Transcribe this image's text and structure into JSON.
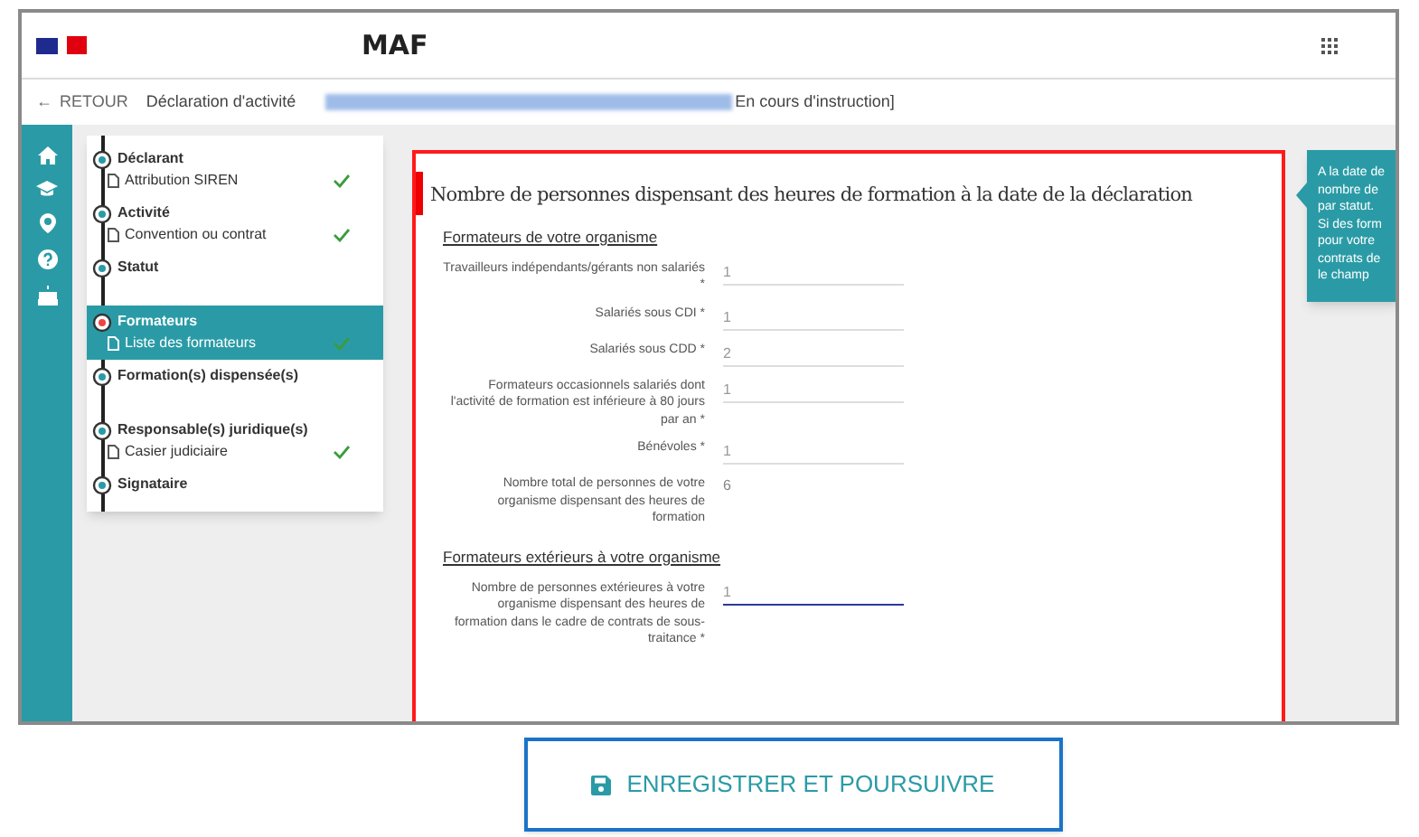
{
  "header": {
    "title": "MAF"
  },
  "breadcrumb": {
    "back_arrow": "←",
    "back": "RETOUR",
    "page": "Déclaration d'activité",
    "status": "En cours d'instruction]"
  },
  "steps": [
    {
      "label": "Déclarant",
      "sub": "Attribution SIREN",
      "checked": true,
      "selected": false
    },
    {
      "label": "Activité",
      "sub": "Convention ou contrat",
      "checked": true,
      "selected": false
    },
    {
      "label": "Statut",
      "checked": false,
      "selected": false
    },
    {
      "label": "Formateurs",
      "sub": "Liste des formateurs",
      "checked": true,
      "selected": true
    },
    {
      "label": "Formation(s) dispensée(s)",
      "checked": false,
      "selected": false
    },
    {
      "label": "Responsable(s) juridique(s)",
      "sub": "Casier judiciaire",
      "checked": true,
      "selected": false
    },
    {
      "label": "Signataire",
      "checked": false,
      "selected": false
    }
  ],
  "form": {
    "title": "Nombre de personnes dispensant des heures de formation à la date de la déclaration",
    "sections": [
      {
        "heading": "Formateurs de votre organisme",
        "fields": [
          {
            "kind": "input",
            "label": "Travailleurs indépendants/gérants non salariés *",
            "value": "1",
            "focused": false
          },
          {
            "kind": "input",
            "label": "Salariés sous CDI *",
            "value": "1",
            "focused": false
          },
          {
            "kind": "input",
            "label": "Salariés sous CDD *",
            "value": "2",
            "focused": false
          },
          {
            "kind": "input",
            "label": "Formateurs occasionnels salariés dont l'activité de formation est inférieure à 80 jours par an *",
            "value": "1",
            "focused": false
          },
          {
            "kind": "input",
            "label": "Bénévoles *",
            "value": "1",
            "focused": false
          },
          {
            "kind": "total",
            "label": "Nombre total de personnes de votre organisme dispensant des heures de formation",
            "value": "6"
          }
        ]
      },
      {
        "heading": "Formateurs extérieurs à votre organisme",
        "fields": [
          {
            "kind": "input",
            "label": "Nombre de personnes extérieures à votre organisme dispensant des heures de formation dans le cadre de contrats de sous-traitance *",
            "value": "1",
            "focused": true
          }
        ]
      }
    ]
  },
  "tooltip": {
    "lines": [
      "A la date de",
      "nombre de",
      "par statut.",
      "Si des form",
      "pour votre",
      "contrats de",
      "le champ"
    ]
  },
  "save_button": {
    "label": "ENREGISTRER ET POURSUIVRE"
  }
}
